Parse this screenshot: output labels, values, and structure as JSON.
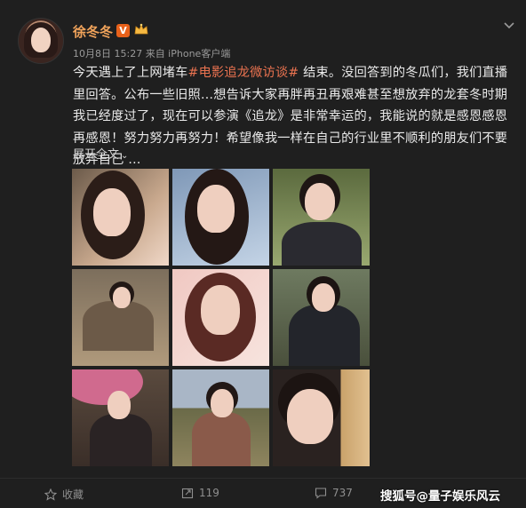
{
  "post": {
    "username": "徐冬冬",
    "verified_badge": "V",
    "meta": "10月8日 15:27 来自 iPhone客户端",
    "text_before": "今天遇上了上网堵车",
    "hashtag": "#电影追龙微访谈#",
    "text_after": " 结束。没回答到的冬瓜们，我们直播里回答。公布一些旧照…想告诉大家再胖再丑再艰难甚至想放弃的龙套冬时期我已经度过了，现在可以参演《追龙》是非常幸运的，我能说的就是感恩感恩再感恩！努力努力再努力！希望像我一样在自己的行业里不顺利的朋友们不要放弃自己 …",
    "expand_label": "展开全文",
    "expand_arrow": "⌄"
  },
  "actions": {
    "favorite_label": "收藏",
    "repost_count": "119",
    "comment_count": "737"
  },
  "watermark": "搜狐号@量子娱乐风云",
  "colors": {
    "background": "#1f1f1f",
    "username": "#f0a35b",
    "hashtag": "#eb7350",
    "badge": "#e8611a"
  },
  "icons": {
    "crown": "crown-icon",
    "chevron": "chevron-down-icon",
    "favorite": "star-icon",
    "repost": "repost-icon",
    "comment": "comment-icon"
  }
}
